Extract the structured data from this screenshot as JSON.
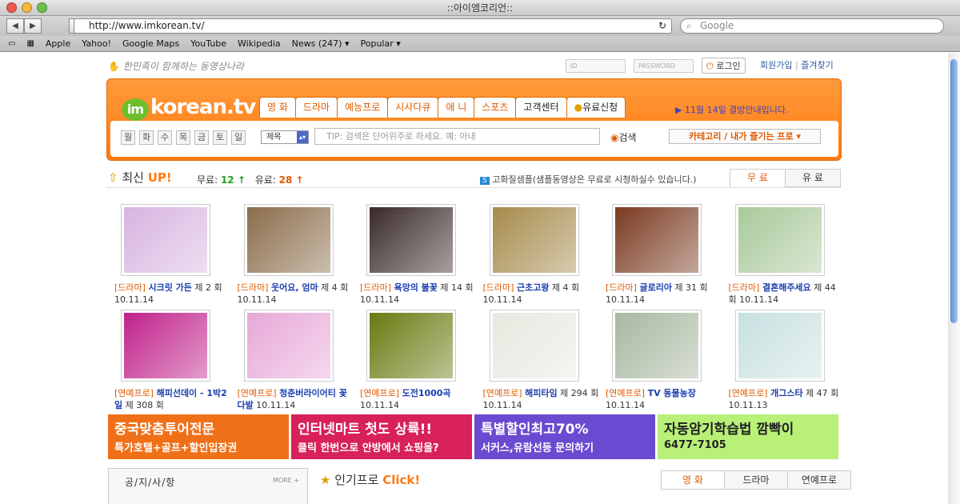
{
  "window": {
    "title": "::아이엠코리언::"
  },
  "browser": {
    "url": "http://www.imkorean.tv/",
    "search_placeholder": "Google",
    "bookmarks": [
      "Apple",
      "Yahoo!",
      "Google Maps",
      "YouTube",
      "Wikipedia",
      "News (247) ▾",
      "Popular ▾"
    ]
  },
  "site": {
    "slogan": "한민족이 함께하는 동영상나라",
    "login": {
      "id_placeholder": "ID",
      "pw_placeholder": "PASSWORD",
      "button": "로그인",
      "join": "회원가입",
      "fav": "즐겨찾기",
      "sep": "|"
    },
    "logo": {
      "im": "im",
      "text": "korean.tv"
    },
    "tabs": [
      "영 화",
      "드라마",
      "예능프로",
      "시사다큐",
      "애 니",
      "스포츠",
      "고객센터",
      "유료신청"
    ],
    "notice": "▶ 11월 14일 결방안내입니다.",
    "days": [
      "월",
      "화",
      "수",
      "목",
      "금",
      "토",
      "일"
    ],
    "search": {
      "select": "제목",
      "placeholder": "TIP: 검색은 단어위주로 하세요. 예: 아내",
      "button": "검색",
      "category": "카테고리 / 내가 즐기는 프로 ▾"
    },
    "latest": {
      "label": "최신",
      "up": "UP!",
      "free_label": "무료:",
      "free_count": "12 ↑",
      "paid_label": "유료:",
      "paid_count": "28 ↑",
      "hq_text": "고화질샘플(샘플동영상은 무료로 시청하실수 있습니다.)",
      "tab_free": "무 료",
      "tab_paid": "유 료"
    },
    "items": [
      {
        "cat": "[드라마]",
        "title": "시크릿 가든",
        "ep": "제 2 회 10.11.14",
        "color": "#d7b4e0"
      },
      {
        "cat": "[드라마]",
        "title": "웃어요, 엄마",
        "ep": "제 4 회 10.11.14",
        "color": "#8a6c4a"
      },
      {
        "cat": "[드라마]",
        "title": "욕망의 불꽃",
        "ep": "제 14 회 10.11.14",
        "color": "#3a2a2a"
      },
      {
        "cat": "[드라마]",
        "title": "근초고왕",
        "ep": "제 4 회 10.11.14",
        "color": "#a58a4a"
      },
      {
        "cat": "[드라마]",
        "title": "글로리아",
        "ep": "제 31 회 10.11.14",
        "color": "#7a3a20"
      },
      {
        "cat": "[드라마]",
        "title": "결혼해주세요",
        "ep": "제 44 회 10.11.14",
        "color": "#a9c99a"
      },
      {
        "cat": "[연예프로]",
        "title": "해피선데이 - 1박2일",
        "ep": "제 308 회",
        "color": "#c0208a"
      },
      {
        "cat": "[연예프로]",
        "title": "청춘버라이어티 꽃다발",
        "ep": "10.11.14",
        "color": "#e7a8d8"
      },
      {
        "cat": "[연예프로]",
        "title": "도전1000곡",
        "ep": "10.11.14",
        "color": "#6a7a10"
      },
      {
        "cat": "[연예프로]",
        "title": "해피타임",
        "ep": "제 294 회 10.11.14",
        "color": "#e8e8e0"
      },
      {
        "cat": "[연예프로]",
        "title": "TV 동물농장",
        "ep": "10.11.14",
        "color": "#a8b8a0"
      },
      {
        "cat": "[연예프로]",
        "title": "개그스타",
        "ep": "제 47 회 10.11.13",
        "color": "#c8e0e0"
      }
    ],
    "banners": [
      {
        "line1": "중국맞춤투어전문",
        "line2": "특가호텔+골프+할인입장권",
        "color": "#f07018"
      },
      {
        "line1": "인터넷마트 첫도 상륙!!",
        "line2": "클릭 한번으로 안방에서 쇼핑을?",
        "color": "#d8205a"
      },
      {
        "line1": "특별할인최고70%",
        "line2": "서커스,유람선등   문의하기",
        "color": "#6a4ad0"
      },
      {
        "line1": "자동암기학습법 깜빡이",
        "line2": "6477-7105",
        "color": "#b8f078"
      }
    ],
    "bottom": {
      "notice_title": "공/지/사/항",
      "more": "MORE +",
      "popular": "인기프로",
      "click": "Click!",
      "tabs": [
        "영 화",
        "드라마",
        "연예프로"
      ]
    }
  }
}
